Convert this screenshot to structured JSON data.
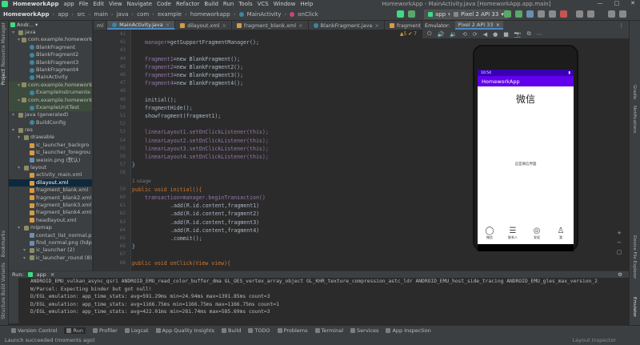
{
  "menubar": {
    "app_name": "HomeworkApp",
    "items": [
      "app",
      "File",
      "Edit",
      "View",
      "Navigate",
      "Code",
      "Refactor",
      "Build",
      "Run",
      "Tools",
      "VCS",
      "Window",
      "Help"
    ],
    "window_title": "HomeworkApp - MainActivity.java [HomeworkApp.app.main]"
  },
  "breadcrumb": [
    "HomeworkApp",
    "app",
    "src",
    "main",
    "java",
    "com",
    "example",
    "homeworkapp",
    "MainActivity",
    "onClick"
  ],
  "toolbar": {
    "run_config": "app",
    "device": "Pixel 2 API 33"
  },
  "project_panel": {
    "title": "Andr...",
    "items": [
      {
        "label": "java",
        "icon": "folder",
        "indent": 0
      },
      {
        "label": "com.example.homework",
        "icon": "folder",
        "indent": 1
      },
      {
        "label": "BlankFragment",
        "icon": "class",
        "indent": 2
      },
      {
        "label": "BlankFragment2",
        "icon": "class",
        "indent": 2
      },
      {
        "label": "BlankFragment3",
        "icon": "class",
        "indent": 2
      },
      {
        "label": "BlankFragment4",
        "icon": "class",
        "indent": 2
      },
      {
        "label": "MainActivity",
        "icon": "class",
        "indent": 2
      },
      {
        "label": "com.example.homework",
        "icon": "folder",
        "indent": 1
      },
      {
        "label": "ExampleInstrumente",
        "icon": "class",
        "indent": 2
      },
      {
        "label": "com.example.homework",
        "icon": "folder",
        "indent": 1
      },
      {
        "label": "ExampleUnitTest",
        "icon": "class",
        "indent": 2
      },
      {
        "label": "java (generated)",
        "icon": "folder",
        "indent": 0
      },
      {
        "label": "BuildConfig",
        "icon": "class",
        "indent": 2
      },
      {
        "label": "res",
        "icon": "folder",
        "indent": 0
      },
      {
        "label": "drawable",
        "icon": "folder",
        "indent": 1
      },
      {
        "label": "ic_launcher_backgro",
        "icon": "xml",
        "indent": 2
      },
      {
        "label": "ic_launcher_foregrou",
        "icon": "xml",
        "indent": 2
      },
      {
        "label": "weixin.png (默认)",
        "icon": "img",
        "indent": 2
      },
      {
        "label": "layout",
        "icon": "folder",
        "indent": 1
      },
      {
        "label": "activity_main.xml",
        "icon": "xml",
        "indent": 2
      },
      {
        "label": "dilayout.xml",
        "icon": "xml",
        "indent": 2
      },
      {
        "label": "fragment_blank.xml",
        "icon": "xml",
        "indent": 2
      },
      {
        "label": "fragment_blank2.xml",
        "icon": "xml",
        "indent": 2
      },
      {
        "label": "fragment_blank3.xml",
        "icon": "xml",
        "indent": 2
      },
      {
        "label": "fragment_blank4.xml",
        "icon": "xml",
        "indent": 2
      },
      {
        "label": "headlayout.xml",
        "icon": "xml",
        "indent": 2
      },
      {
        "label": "mipmap",
        "icon": "folder",
        "indent": 1
      },
      {
        "label": "contact_list_normal.p",
        "icon": "img",
        "indent": 2
      },
      {
        "label": "find_normal.png (hdp",
        "icon": "img",
        "indent": 2
      },
      {
        "label": "ic_launcher (2)",
        "icon": "folder",
        "indent": 2
      },
      {
        "label": "ic_launcher_round (8)",
        "icon": "folder",
        "indent": 2
      }
    ]
  },
  "left_strip_labels": [
    "Resource Manager",
    "Project",
    "Bookmarks",
    "Build Variants",
    "Structure"
  ],
  "right_strip_labels": [
    "Gradle",
    "Notifications",
    "Device File Explorer",
    "Emulator"
  ],
  "editor_tabs": [
    {
      "label": "MainActivity.java",
      "active": true
    },
    {
      "label": "dilayout.xml",
      "active": false
    },
    {
      "label": "fragment_blank.xml",
      "active": false
    },
    {
      "label": "BlankFragment.java",
      "active": false
    },
    {
      "label": "fragment_blank2.xml",
      "active": false
    }
  ],
  "inspection": "▲5  ✔ 7",
  "code": {
    "line_numbers": [
      "41",
      "42",
      "43",
      "44",
      "45",
      "46",
      "47",
      "48",
      "49",
      "50",
      "51",
      "52",
      "53",
      "54",
      "55",
      "56",
      "57",
      "58",
      "59",
      "60",
      "61",
      "62",
      "63",
      "64",
      "65",
      "66",
      "67",
      "68",
      "69",
      "70",
      "71"
    ],
    "usage_hint": "1 usage",
    "lines": [
      {
        "t": ""
      },
      {
        "t": "manager",
        "cls": "fld",
        "rest": "=getSupportFragmentManager();"
      },
      {
        "t": ""
      },
      {
        "t": "fragment1",
        "cls": "fld",
        "rest": "=new BlankFragment();"
      },
      {
        "t": "fragment2",
        "cls": "fld",
        "rest": "=new BlankFragment2();"
      },
      {
        "t": "fragment3",
        "cls": "fld",
        "rest": "=new BlankFragment3();"
      },
      {
        "t": "fragment4",
        "cls": "fld",
        "rest": "=new BlankFragment4();"
      },
      {
        "t": ""
      },
      {
        "t": "initial();"
      },
      {
        "t": "fragmentHide();"
      },
      {
        "t": "showfragment(fragment1);"
      },
      {
        "t": ""
      },
      {
        "t": "linearLayout1.setOnClickListener(this);"
      },
      {
        "t": "linearLayout2.setOnClickListener(this);"
      },
      {
        "t": "linearLayout3.setOnClickListener(this);"
      },
      {
        "t": "linearLayout4.setOnClickListener(this);"
      },
      {
        "t": "}"
      },
      {
        "t": ""
      },
      {
        "t": "public void initial(){"
      },
      {
        "t": "transaction=manager.beginTransaction()"
      },
      {
        "t": ".add(R.id.content,fragment1)"
      },
      {
        "t": ".add(R.id.content,fragment2)"
      },
      {
        "t": ".add(R.id.content,fragment3)"
      },
      {
        "t": ".add(R.id.content,fragment4)"
      },
      {
        "t": ".commit();"
      },
      {
        "t": "}"
      },
      {
        "t": ""
      },
      {
        "t": "public void onClick(View view){"
      }
    ]
  },
  "emulator": {
    "tool_title": "Emulator:",
    "device_tab": "Pixel 2 API 33",
    "phone": {
      "status_time": "10:54",
      "app_title": "HomeworkApp",
      "big_title": "微信",
      "center_text": "这是微信界面",
      "tabs": [
        {
          "label": "微信",
          "icon": "chat-bubble-icon"
        },
        {
          "label": "联系人",
          "icon": "contacts-icon"
        },
        {
          "label": "发现",
          "icon": "compass-icon"
        },
        {
          "label": "我",
          "icon": "person-icon"
        }
      ]
    }
  },
  "run_panel": {
    "title": "Run:",
    "config": "app",
    "console_lines": [
      "ANDROID_EMU_vulkan_async_qsri ANDROID_EMU_read_color_buffer_dma GL_OES_vertex_array_object GL_KHR_texture_compression_astc_ldr ANDROID_EMU_host_side_tracing ANDROID_EMU_gles_max_version_2",
      "W/Parcel: Expecting binder but got null!",
      "D/EGL_emulation: app_time_stats: avg=591.29ms min=24.94ms max=1391.85ms count=3",
      "D/EGL_emulation: app_time_stats: avg=1166.75ms min=1166.75ms max=1166.75ms count=1",
      "D/EGL_emulation: app_time_stats: avg=422.01ms min=281.74ms max=585.69ms count=3"
    ]
  },
  "bottom_tabs": [
    "Version Control",
    "Run",
    "Profiler",
    "Logcat",
    "App Quality Insights",
    "Build",
    "TODO",
    "Problems",
    "Terminal",
    "Services",
    "App Inspection"
  ],
  "status": {
    "message": "Launch succeeded (moments ago)",
    "right": "Layout Inspector"
  },
  "colors": {
    "accent": "#4a88c7",
    "app_bar": "#6200ee",
    "status_bar": "#3700b3",
    "run_green": "#3ddc84"
  }
}
